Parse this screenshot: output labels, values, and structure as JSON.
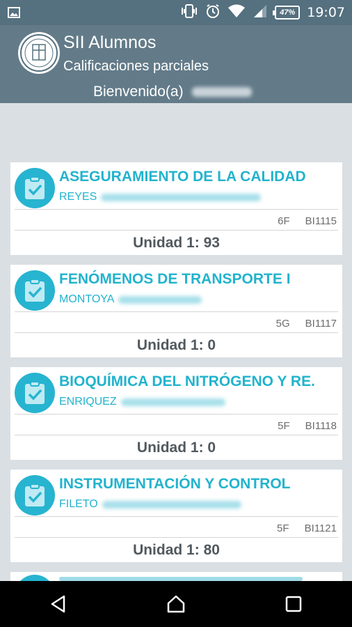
{
  "status_bar": {
    "battery": "47%",
    "time": "19:07",
    "icons": [
      "image-icon",
      "vibrate-icon",
      "alarm-icon",
      "wifi-icon",
      "signal-icon",
      "battery-icon"
    ]
  },
  "header": {
    "title": "SII Alumnos",
    "subtitle": "Calificaciones parciales",
    "welcome": "Bienvenido(a)"
  },
  "courses": [
    {
      "title": "ASEGURAMIENTO DE LA CALIDAD",
      "teacher": "REYES",
      "group": "6F",
      "code": "BI1115",
      "grade": "Unidad 1: 93"
    },
    {
      "title": "FENÓMENOS DE TRANSPORTE I",
      "teacher": "MONTOYA",
      "group": "5G",
      "code": "BI1117",
      "grade": "Unidad 1: 0"
    },
    {
      "title": "BIOQUÍMICA DEL NITRÓGENO Y RE.",
      "teacher": "ENRIQUEZ",
      "group": "5F",
      "code": "BI1118",
      "grade": "Unidad 1: 0"
    },
    {
      "title": "INSTRUMENTACIÓN Y CONTROL",
      "teacher": "FILETO",
      "group": "5F",
      "code": "BI1121",
      "grade": "Unidad 1: 80"
    }
  ],
  "colors": {
    "accent": "#22b3cd",
    "header": "#637b89",
    "status_bar": "#55707f",
    "background": "#d9dfe2"
  },
  "nav": {
    "back_icon": "back-triangle-icon",
    "home_icon": "home-icon",
    "recents_icon": "recents-square-icon"
  }
}
